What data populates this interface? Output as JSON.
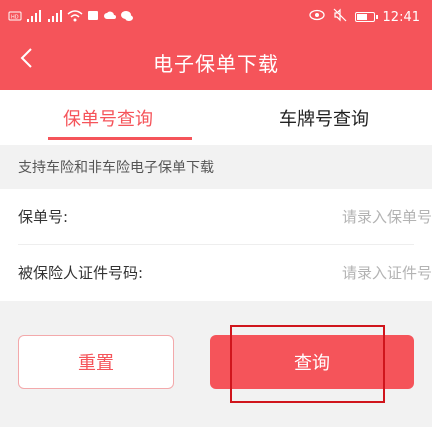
{
  "status_bar": {
    "time": "12:41",
    "left_icons": [
      "hd-icon",
      "signal-icon",
      "signal-icon",
      "wifi-icon",
      "notification-icon",
      "cloud-icon",
      "wechat-icon"
    ],
    "right_icons": [
      "eye-icon",
      "mute-icon",
      "battery-icon"
    ]
  },
  "nav": {
    "title": "电子保单下载",
    "back_icon": "chevron-left-icon"
  },
  "tabs": [
    {
      "label": "保单号查询",
      "active": true
    },
    {
      "label": "车牌号查询",
      "active": false
    }
  ],
  "notice": "支持车险和非车险电子保单下载",
  "form": {
    "policy_number": {
      "label": "保单号:",
      "placeholder": "请录入保单号",
      "value": ""
    },
    "id_number": {
      "label": "被保险人证件号码:",
      "placeholder": "请录入证件号",
      "value": ""
    }
  },
  "buttons": {
    "reset": "重置",
    "query": "查询"
  },
  "colors": {
    "brand": "#f5545a",
    "highlight": "#d0151c"
  }
}
